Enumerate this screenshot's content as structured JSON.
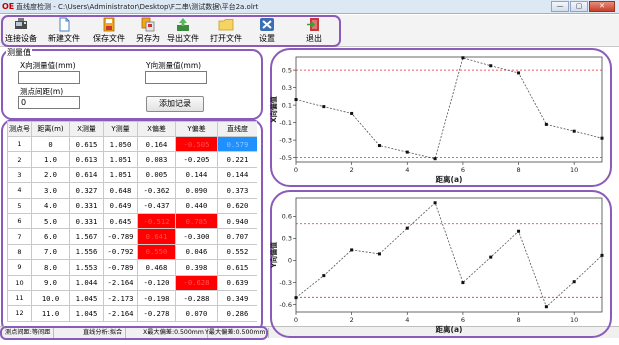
{
  "window": {
    "app_icon": "OE",
    "title": "直线度检测 - C:\\Users\\Administrator\\Desktop\\F二串\\测试数据\\平台2a.olrt",
    "minimize": "—",
    "maximize": "▢",
    "close": "✕"
  },
  "toolbar": {
    "connect": "连接设备",
    "new_file": "新建文件",
    "save_file": "保存文件",
    "save_as": "另存为",
    "export_file": "导出文件",
    "open_file": "打开文件",
    "settings": "设置",
    "exit": "退出"
  },
  "measure": {
    "group_title": "测量值",
    "x_label": "X向测量值(mm)",
    "x_value": "",
    "y_label": "Y向测量值(mm)",
    "y_value": "",
    "spacing_label": "测点间距(m)",
    "spacing_value": "0",
    "add_button": "添加记录"
  },
  "table": {
    "headers": [
      "测点号",
      "距离(m)",
      "X测量",
      "Y测量",
      "X偏差",
      "Y偏差",
      "直线度"
    ],
    "rows": [
      [
        "1",
        "0",
        "0.615",
        "1.050",
        "0.164",
        "-0.505",
        "0.579"
      ],
      [
        "2",
        "1.0",
        "0.613",
        "1.051",
        "0.083",
        "-0.205",
        "0.221"
      ],
      [
        "3",
        "2.0",
        "0.614",
        "1.051",
        "0.005",
        "0.144",
        "0.144"
      ],
      [
        "4",
        "3.0",
        "0.327",
        "0.648",
        "-0.362",
        "0.090",
        "0.373"
      ],
      [
        "5",
        "4.0",
        "0.331",
        "0.649",
        "-0.437",
        "0.440",
        "0.620"
      ],
      [
        "6",
        "5.0",
        "0.331",
        "0.645",
        "-0.512",
        "0.785",
        "0.940"
      ],
      [
        "7",
        "6.0",
        "1.567",
        "-0.789",
        "0.641",
        "-0.300",
        "0.707"
      ],
      [
        "8",
        "7.0",
        "1.556",
        "-0.792",
        "0.550",
        "0.046",
        "0.552"
      ],
      [
        "9",
        "8.0",
        "1.553",
        "-0.789",
        "0.468",
        "0.398",
        "0.615"
      ],
      [
        "10",
        "9.0",
        "1.044",
        "-2.164",
        "-0.120",
        "-0.628",
        "0.639"
      ],
      [
        "11",
        "10.0",
        "1.045",
        "-2.173",
        "-0.198",
        "-0.288",
        "0.349"
      ],
      [
        "12",
        "11.0",
        "1.045",
        "-2.164",
        "-0.278",
        "0.070",
        "0.286"
      ]
    ],
    "highlights": [
      {
        "row": 0,
        "col": 5,
        "kind": "red"
      },
      {
        "row": 0,
        "col": 6,
        "kind": "blue"
      },
      {
        "row": 5,
        "col": 4,
        "kind": "red"
      },
      {
        "row": 5,
        "col": 5,
        "kind": "red"
      },
      {
        "row": 6,
        "col": 4,
        "kind": "red"
      },
      {
        "row": 7,
        "col": 4,
        "kind": "red"
      },
      {
        "row": 9,
        "col": 5,
        "kind": "red"
      }
    ]
  },
  "status": {
    "mode": "测点间距:等间距",
    "analysis": "直线分析:拟合",
    "x_max": "X最大偏差:0.500mm",
    "y_max": "Y最大偏差:0.500mm"
  },
  "chart_data": [
    {
      "type": "line",
      "xlabel": "距离(a)",
      "ylabel": "X向偏值",
      "xlim": [
        0,
        11
      ],
      "ylim": [
        -0.55,
        0.65
      ],
      "xticks": [
        0,
        2,
        4,
        6,
        8,
        10
      ],
      "yticks": [
        -0.5,
        -0.3,
        -0.1,
        0.1,
        0.3,
        0.5
      ],
      "tolerance": [
        -0.5,
        0.5
      ],
      "x": [
        0,
        1,
        2,
        3,
        4,
        5,
        6,
        7,
        8,
        9,
        10,
        11
      ],
      "y": [
        0.164,
        0.083,
        0.005,
        -0.362,
        -0.437,
        -0.512,
        0.641,
        0.55,
        0.468,
        -0.12,
        -0.198,
        -0.278
      ],
      "colors": {
        "line": "#555555",
        "tolerance": "#e03030"
      }
    },
    {
      "type": "line",
      "xlabel": "距离(a)",
      "ylabel": "Y向偏值",
      "xlim": [
        0,
        11
      ],
      "ylim": [
        -0.7,
        0.85
      ],
      "xticks": [
        0,
        2,
        4,
        6,
        8,
        10
      ],
      "yticks": [
        -0.6,
        -0.3,
        0,
        0.3,
        0.6
      ],
      "tolerance": [
        -0.5,
        0.5
      ],
      "x": [
        0,
        1,
        2,
        3,
        4,
        5,
        6,
        7,
        8,
        9,
        10,
        11
      ],
      "y": [
        -0.505,
        -0.205,
        0.144,
        0.09,
        0.44,
        0.785,
        -0.3,
        0.046,
        0.398,
        -0.628,
        -0.288,
        0.07
      ],
      "colors": {
        "line": "#555555",
        "tolerance": "#e03030"
      }
    }
  ]
}
